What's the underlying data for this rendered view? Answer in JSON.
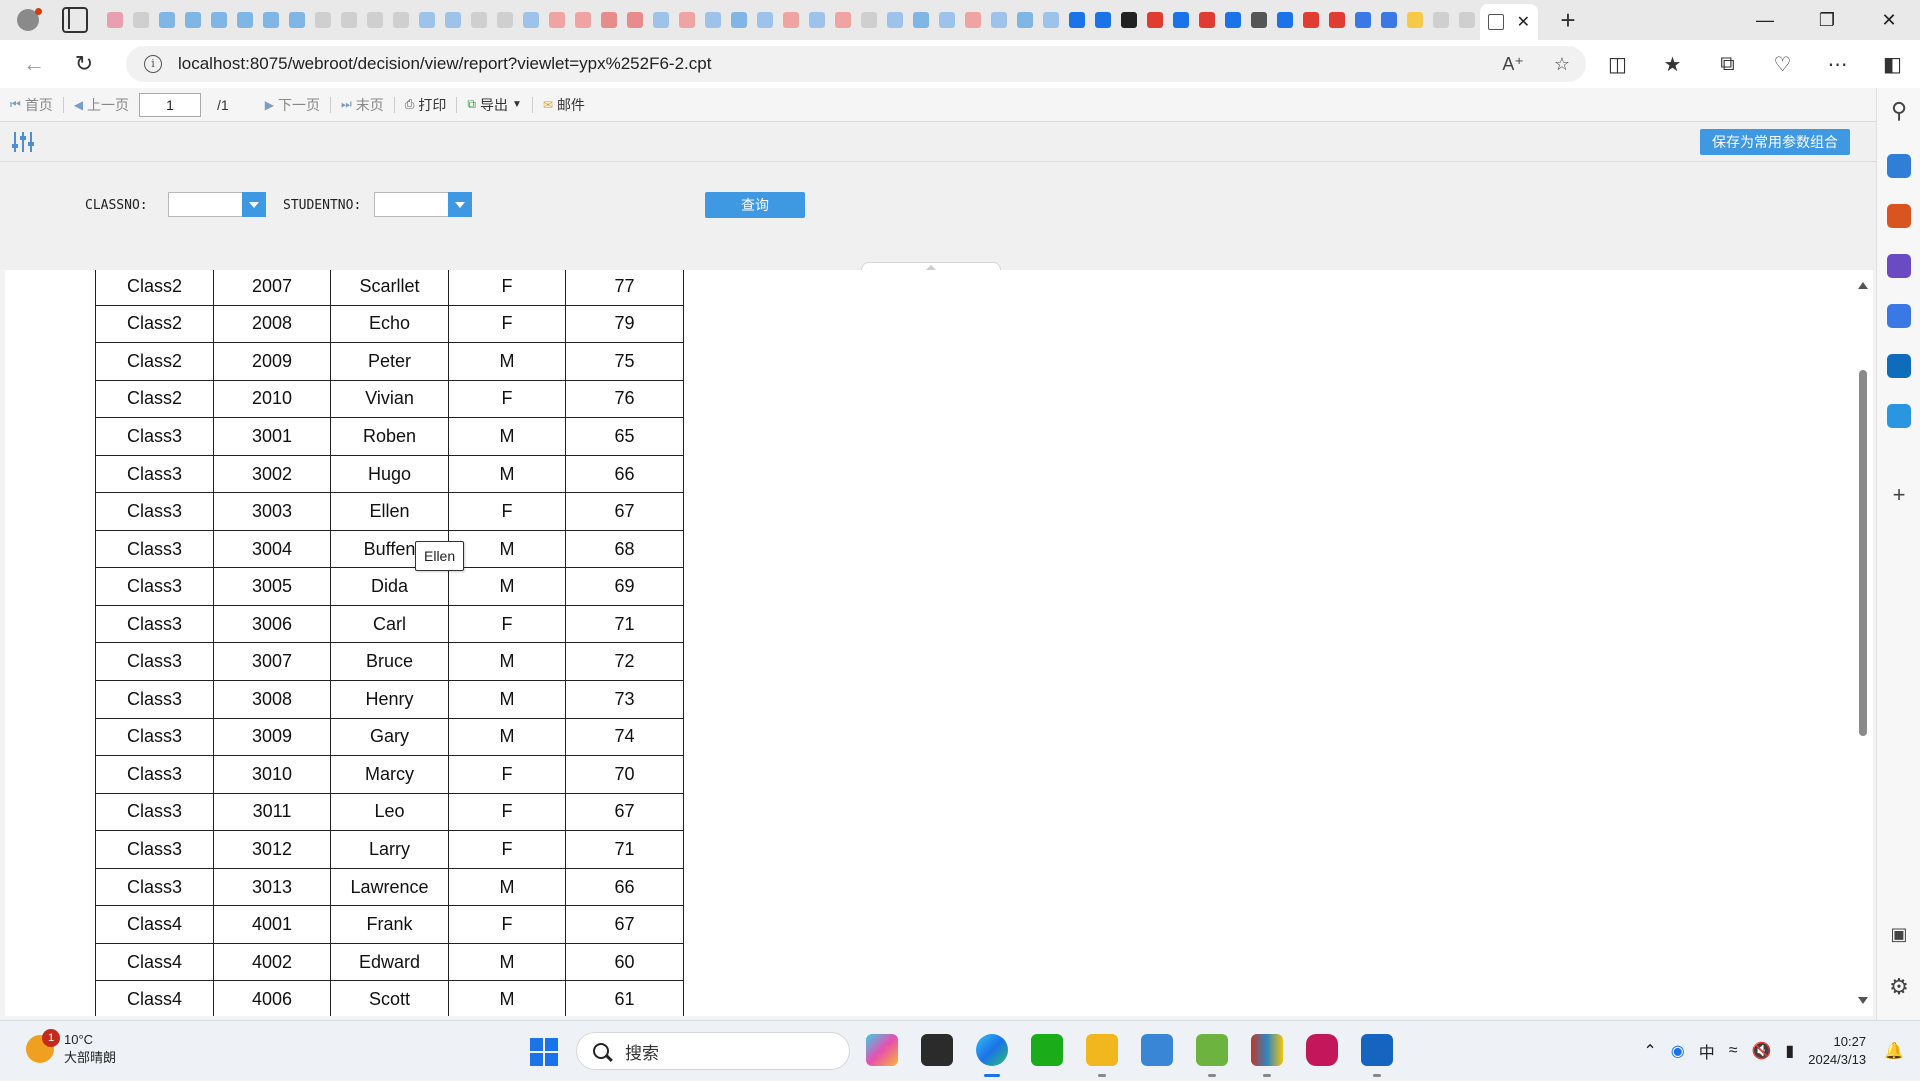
{
  "browser": {
    "url": "localhost:8075/webroot/decision/view/report?viewlet=ypx%252F6-2.cpt",
    "close_tab": "✕",
    "new_tab": "+",
    "window_controls": [
      "—",
      "❐",
      "✕"
    ]
  },
  "toolbar": {
    "first": "首页",
    "prev": "上一页",
    "page_value": "1",
    "page_total": "/1",
    "next": "下一页",
    "last": "末页",
    "print": "打印",
    "export": "导出",
    "mail": "邮件"
  },
  "params": {
    "save_button": "保存为常用参数组合",
    "classno_label": "CLASSNO:",
    "classno_value": "",
    "studentno_label": "STUDENTNO:",
    "studentno_value": "",
    "query_button": "查询"
  },
  "report": {
    "rows": [
      [
        "Class2",
        "2007",
        "Scarllet",
        "F",
        "77"
      ],
      [
        "Class2",
        "2008",
        "Echo",
        "F",
        "79"
      ],
      [
        "Class2",
        "2009",
        "Peter",
        "M",
        "75"
      ],
      [
        "Class2",
        "2010",
        "Vivian",
        "F",
        "76"
      ],
      [
        "Class3",
        "3001",
        "Roben",
        "M",
        "65"
      ],
      [
        "Class3",
        "3002",
        "Hugo",
        "M",
        "66"
      ],
      [
        "Class3",
        "3003",
        "Ellen",
        "F",
        "67"
      ],
      [
        "Class3",
        "3004",
        "Buffen",
        "M",
        "68"
      ],
      [
        "Class3",
        "3005",
        "Dida",
        "M",
        "69"
      ],
      [
        "Class3",
        "3006",
        "Carl",
        "F",
        "71"
      ],
      [
        "Class3",
        "3007",
        "Bruce",
        "M",
        "72"
      ],
      [
        "Class3",
        "3008",
        "Henry",
        "M",
        "73"
      ],
      [
        "Class3",
        "3009",
        "Gary",
        "M",
        "74"
      ],
      [
        "Class3",
        "3010",
        "Marcy",
        "F",
        "70"
      ],
      [
        "Class3",
        "3011",
        "Leo",
        "F",
        "67"
      ],
      [
        "Class3",
        "3012",
        "Larry",
        "F",
        "71"
      ],
      [
        "Class3",
        "3013",
        "Lawrence",
        "M",
        "66"
      ],
      [
        "Class4",
        "4001",
        "Frank",
        "F",
        "67"
      ],
      [
        "Class4",
        "4002",
        "Edward",
        "M",
        "60"
      ],
      [
        "Class4",
        "4006",
        "Scott",
        "M",
        "61"
      ]
    ],
    "tooltip": "Ellen"
  },
  "taskbar": {
    "weather_temp": "10°C",
    "weather_desc": "大部晴朗",
    "weather_badge": "1",
    "search_placeholder": "搜索",
    "ime": "中",
    "time": "10:27",
    "date": "2024/3/13"
  },
  "colors": {
    "accent": "#3e98e2",
    "edge_blue": "#1a73e8"
  }
}
